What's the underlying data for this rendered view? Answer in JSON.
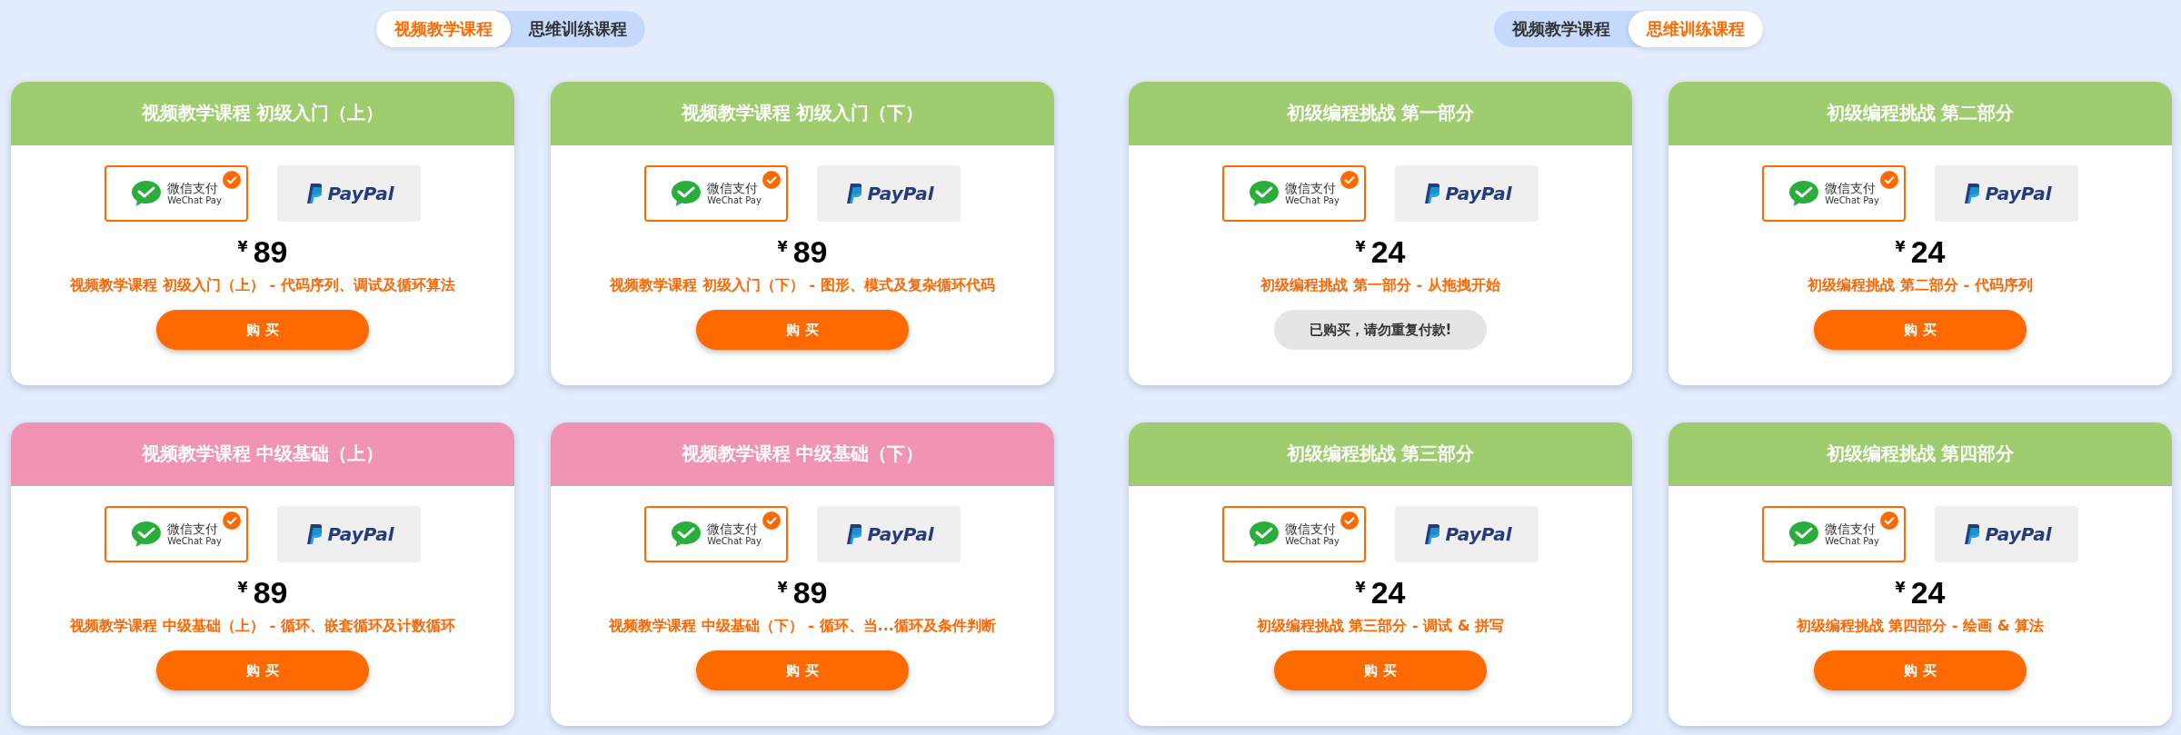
{
  "panels": [
    {
      "tabs": [
        {
          "label": "视频教学课程",
          "selected": true
        },
        {
          "label": "思维训练课程",
          "selected": false
        }
      ],
      "cards": [
        {
          "title": "视频教学课程 初级入门（上）",
          "color": "#9fcc6e",
          "payments": [
            {
              "kind": "wechat",
              "label": "微信支付",
              "sublabel": "WeChat Pay",
              "selected": true
            },
            {
              "kind": "paypal",
              "label": "PayPal",
              "selected": false
            }
          ],
          "currency": "¥",
          "price": "89",
          "description": "视频教学课程 初级入门（上） - 代码序列、调试及循环算法",
          "action": {
            "kind": "buy",
            "label": "购 买"
          }
        },
        {
          "title": "视频教学课程 初级入门（下）",
          "color": "#9fcc6e",
          "payments": [
            {
              "kind": "wechat",
              "label": "微信支付",
              "sublabel": "WeChat Pay",
              "selected": true
            },
            {
              "kind": "paypal",
              "label": "PayPal",
              "selected": false
            }
          ],
          "currency": "¥",
          "price": "89",
          "description": "视频教学课程 初级入门（下） - 图形、模式及复杂循环代码",
          "action": {
            "kind": "buy",
            "label": "购 买"
          }
        },
        {
          "title": "视频教学课程 中级基础（上）",
          "color": "#f194b3",
          "payments": [
            {
              "kind": "wechat",
              "label": "微信支付",
              "sublabel": "WeChat Pay",
              "selected": true
            },
            {
              "kind": "paypal",
              "label": "PayPal",
              "selected": false
            }
          ],
          "currency": "¥",
          "price": "89",
          "description": "视频教学课程 中级基础（上） - 循环、嵌套循环及计数循环",
          "action": {
            "kind": "buy",
            "label": "购 买"
          }
        },
        {
          "title": "视频教学课程 中级基础（下）",
          "color": "#f194b3",
          "payments": [
            {
              "kind": "wechat",
              "label": "微信支付",
              "sublabel": "WeChat Pay",
              "selected": true
            },
            {
              "kind": "paypal",
              "label": "PayPal",
              "selected": false
            }
          ],
          "currency": "¥",
          "price": "89",
          "description": "视频教学课程 中级基础（下） - 循环、当...循环及条件判断",
          "action": {
            "kind": "buy",
            "label": "购 买"
          }
        }
      ]
    },
    {
      "tabs": [
        {
          "label": "视频教学课程",
          "selected": false
        },
        {
          "label": "思维训练课程",
          "selected": true
        }
      ],
      "cards": [
        {
          "title": "初级编程挑战 第一部分",
          "color": "#9fcc6e",
          "payments": [
            {
              "kind": "wechat",
              "label": "微信支付",
              "sublabel": "WeChat Pay",
              "selected": true
            },
            {
              "kind": "paypal",
              "label": "PayPal",
              "selected": false
            }
          ],
          "currency": "¥",
          "price": "24",
          "description": "初级编程挑战 第一部分 - 从拖拽开始",
          "action": {
            "kind": "purchased",
            "label": "已购买，请勿重复付款!"
          }
        },
        {
          "title": "初级编程挑战 第二部分",
          "color": "#9fcc6e",
          "payments": [
            {
              "kind": "wechat",
              "label": "微信支付",
              "sublabel": "WeChat Pay",
              "selected": true
            },
            {
              "kind": "paypal",
              "label": "PayPal",
              "selected": false
            }
          ],
          "currency": "¥",
          "price": "24",
          "description": "初级编程挑战 第二部分 - 代码序列",
          "action": {
            "kind": "buy",
            "label": "购 买"
          }
        },
        {
          "title": "初级编程挑战 第三部分",
          "color": "#9fcc6e",
          "payments": [
            {
              "kind": "wechat",
              "label": "微信支付",
              "sublabel": "WeChat Pay",
              "selected": true
            },
            {
              "kind": "paypal",
              "label": "PayPal",
              "selected": false
            }
          ],
          "currency": "¥",
          "price": "24",
          "description": "初级编程挑战 第三部分 - 调试 & 拼写",
          "action": {
            "kind": "buy",
            "label": "购 买"
          }
        },
        {
          "title": "初级编程挑战 第四部分",
          "color": "#9fcc6e",
          "payments": [
            {
              "kind": "wechat",
              "label": "微信支付",
              "sublabel": "WeChat Pay",
              "selected": true
            },
            {
              "kind": "paypal",
              "label": "PayPal",
              "selected": false
            }
          ],
          "currency": "¥",
          "price": "24",
          "description": "初级编程挑战 第四部分 - 绘画 & 算法",
          "action": {
            "kind": "buy",
            "label": "购 买"
          }
        }
      ]
    }
  ]
}
